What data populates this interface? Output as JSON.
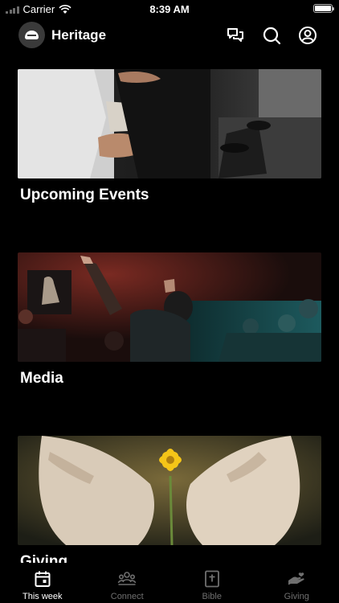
{
  "status_bar": {
    "carrier": "Carrier",
    "time": "8:39 AM"
  },
  "header": {
    "title": "Heritage",
    "icons": [
      "chat-icon",
      "search-icon",
      "profile-icon"
    ]
  },
  "cards": [
    {
      "title": "Upcoming Events",
      "image": "worship-hands-photo"
    },
    {
      "title": "Media",
      "image": "concert-crowd-photo"
    },
    {
      "title": "Giving",
      "image": "hands-flower-photo"
    }
  ],
  "tab_bar": {
    "active": "This week",
    "tabs": [
      {
        "label": "This week",
        "icon": "calendar-icon"
      },
      {
        "label": "Connect",
        "icon": "group-icon"
      },
      {
        "label": "Bible",
        "icon": "bible-icon"
      },
      {
        "label": "Giving",
        "icon": "giving-hand-icon"
      }
    ]
  },
  "colors": {
    "background": "#000000",
    "text": "#ffffff",
    "inactive_tab": "#6f6f6f"
  }
}
